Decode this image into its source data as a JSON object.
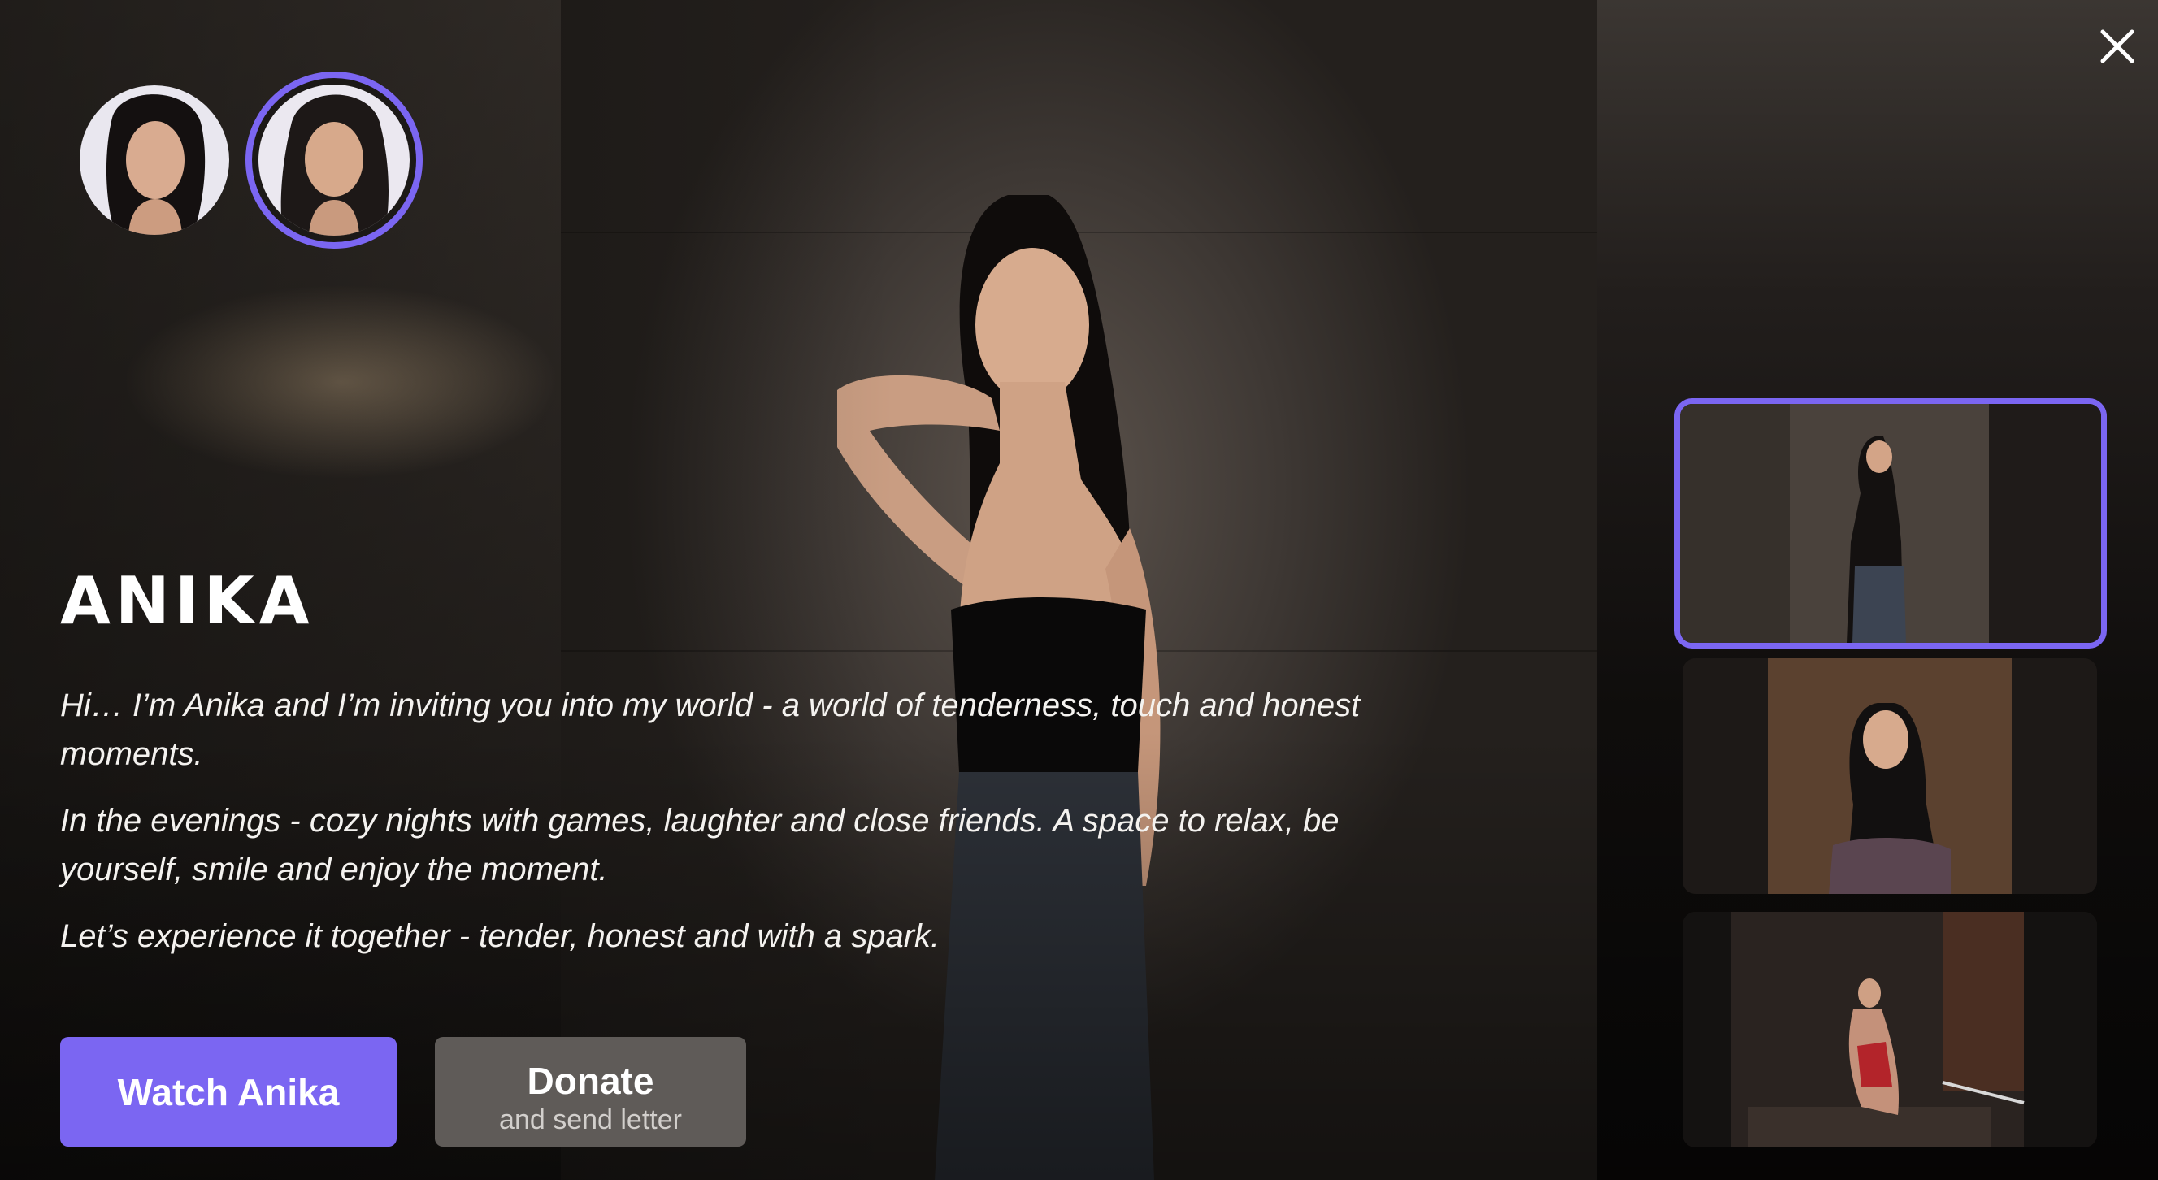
{
  "model": {
    "name": "ANIKA",
    "bio": [
      "Hi… I’m Anika and I’m inviting you into my world - a world of tenderness, touch and honest moments.",
      "In the evenings - cozy nights with games, laughter and close friends. A space to relax, be yourself, smile and enjoy the moment.",
      "Let’s experience it together - tender, honest and with a spark."
    ]
  },
  "actions": {
    "watch_label": "Watch Anika",
    "donate_label": "Donate",
    "donate_sublabel": "and send letter"
  },
  "avatars": [
    {
      "icon": "avatar-photo",
      "selected": false
    },
    {
      "icon": "avatar-photo",
      "selected": true
    }
  ],
  "gallery": [
    {
      "icon": "photo-thumbnail",
      "selected": true
    },
    {
      "icon": "photo-thumbnail",
      "selected": false
    },
    {
      "icon": "photo-thumbnail",
      "selected": false
    }
  ],
  "colors": {
    "accent": "#7b66f2",
    "secondary_button": "#5f5b58",
    "text": "#ffffff"
  },
  "close_icon": "close-icon"
}
